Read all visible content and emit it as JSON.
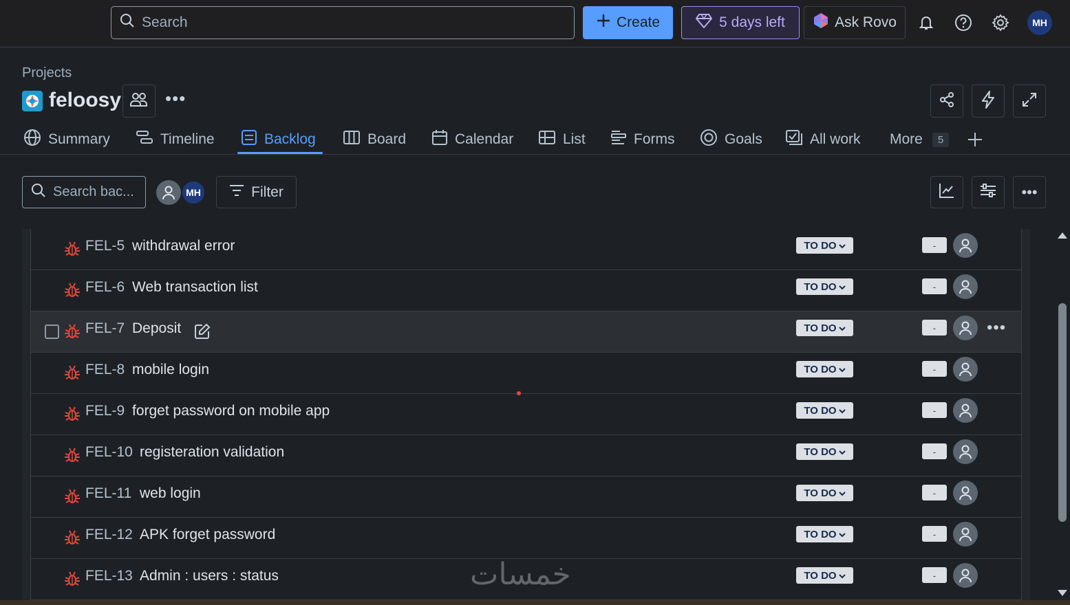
{
  "topbar": {
    "search_placeholder": "Search",
    "create_label": "Create",
    "trial_label": "5 days left",
    "rovo_label": "Ask Rovo",
    "user_initials": "MH"
  },
  "project": {
    "breadcrumb": "Projects",
    "name": "feloosy"
  },
  "tabs": [
    {
      "label": "Summary"
    },
    {
      "label": "Timeline"
    },
    {
      "label": "Backlog"
    },
    {
      "label": "Board"
    },
    {
      "label": "Calendar"
    },
    {
      "label": "List"
    },
    {
      "label": "Forms"
    },
    {
      "label": "Goals"
    },
    {
      "label": "All work"
    },
    {
      "label": "More",
      "badge": "5"
    }
  ],
  "toolbar": {
    "search_placeholder": "Search bac...",
    "user_initials": "MH",
    "filter_label": "Filter"
  },
  "issues": [
    {
      "key": "FEL-5",
      "summary": "withdrawal error",
      "status": "TO DO",
      "estimate": "-"
    },
    {
      "key": "FEL-6",
      "summary": "Web transaction list",
      "status": "TO DO",
      "estimate": "-"
    },
    {
      "key": "FEL-7",
      "summary": "Deposit",
      "status": "TO DO",
      "estimate": "-"
    },
    {
      "key": "FEL-8",
      "summary": "mobile login",
      "status": "TO DO",
      "estimate": "-"
    },
    {
      "key": "FEL-9",
      "summary": "forget password on mobile app",
      "status": "TO DO",
      "estimate": "-"
    },
    {
      "key": "FEL-10",
      "summary": "registeration validation",
      "status": "TO DO",
      "estimate": "-"
    },
    {
      "key": "FEL-11",
      "summary": "web login",
      "status": "TO DO",
      "estimate": "-"
    },
    {
      "key": "FEL-12",
      "summary": "APK forget password",
      "status": "TO DO",
      "estimate": "-"
    },
    {
      "key": "FEL-13",
      "summary": "Admin : users : status",
      "status": "TO DO",
      "estimate": "-"
    }
  ],
  "watermark": "خمسات",
  "colors": {
    "accent": "#579dff",
    "bug": "#e2483d",
    "trial": "#9f8fef"
  }
}
